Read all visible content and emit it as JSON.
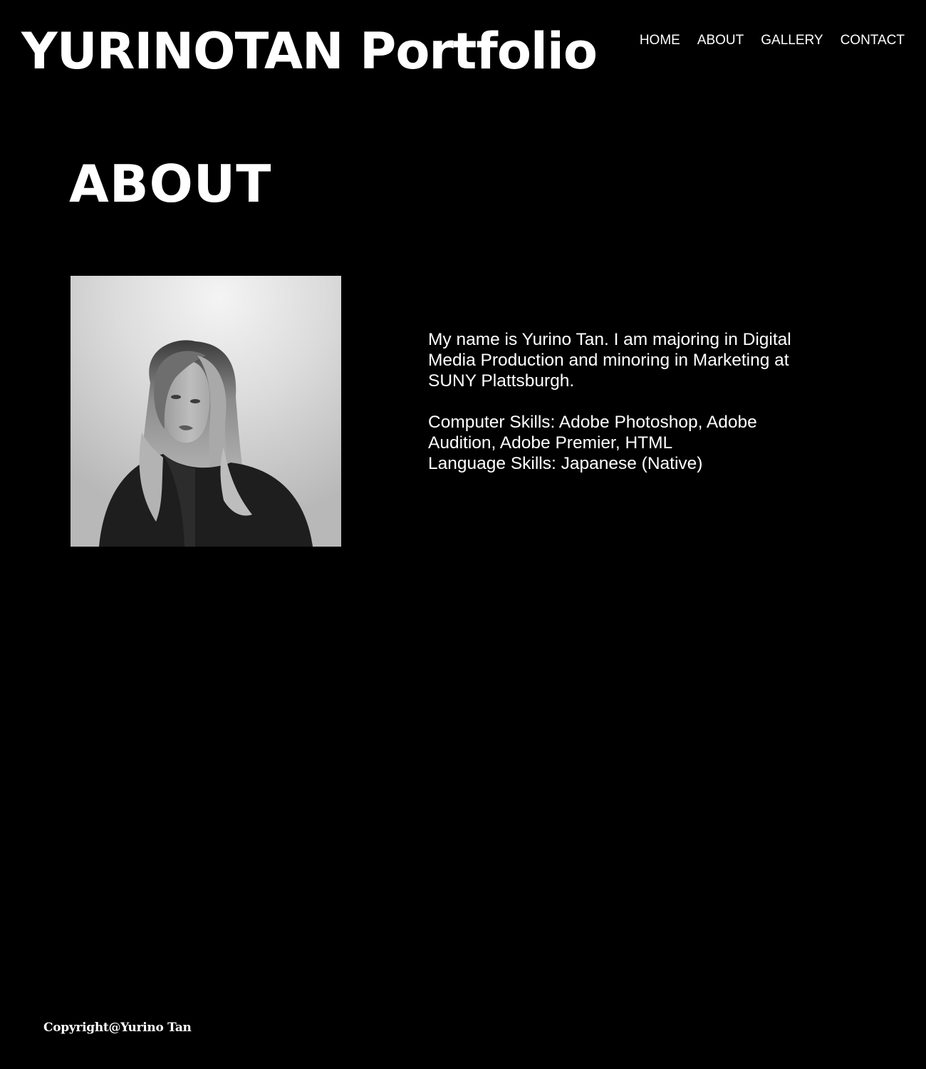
{
  "header": {
    "site_title": "YURINOTAN Portfolio",
    "nav": [
      {
        "label": "HOME"
      },
      {
        "label": "ABOUT"
      },
      {
        "label": "GALLERY"
      },
      {
        "label": "CONTACT"
      }
    ]
  },
  "main": {
    "heading": "ABOUT",
    "portrait_alt": "Yurino Tan portrait",
    "bio": {
      "intro": "My name is Yurino Tan. I am majoring in Digital Media Production and minoring in Marketing at SUNY Plattsburgh.",
      "computer_skills": "Computer Skills: Adobe Photoshop, Adobe Audition, Adobe Premier, HTML",
      "language_skills": "Language Skills: Japanese (Native)"
    }
  },
  "footer": {
    "copyright": "Copyright@Yurino Tan"
  },
  "colors": {
    "background": "#000000",
    "text": "#ffffff"
  }
}
